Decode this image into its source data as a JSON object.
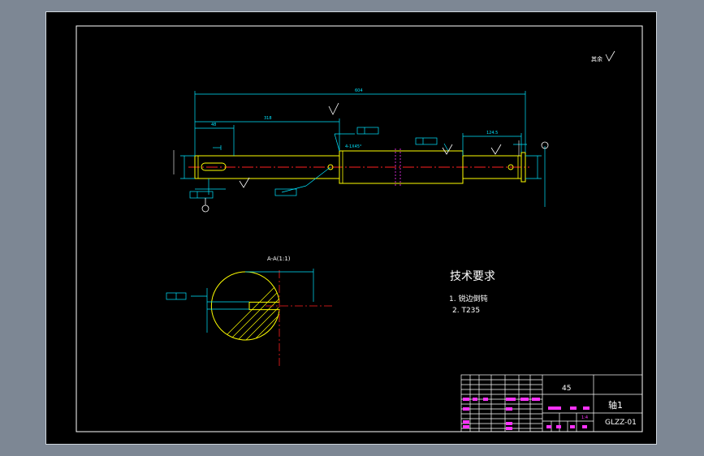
{
  "title_block": {
    "material": "45",
    "part_name": "轴1",
    "drawing_number": "GLZZ-01",
    "scale": "1:4"
  },
  "technical_requirements": {
    "heading": "技术要求",
    "items": [
      "1. 锐边倒钝",
      "2. T235"
    ]
  },
  "section_view": {
    "label": "A-A(1:1)"
  },
  "roughness_note": {
    "text": "其余"
  },
  "dimensions": {
    "overall_length": "604",
    "left_step_length": "318",
    "left_end_length": "48",
    "right_step_length": "124.5",
    "chamfer_note": "4-1X45°"
  },
  "colors": {
    "background": "#000000",
    "frame": "#ffffff",
    "outline": "#ffff00",
    "dimension": "#00e5ff",
    "centerline": "#ff2020",
    "hatch": "#ffff00",
    "annotation": "#ff33ff"
  }
}
